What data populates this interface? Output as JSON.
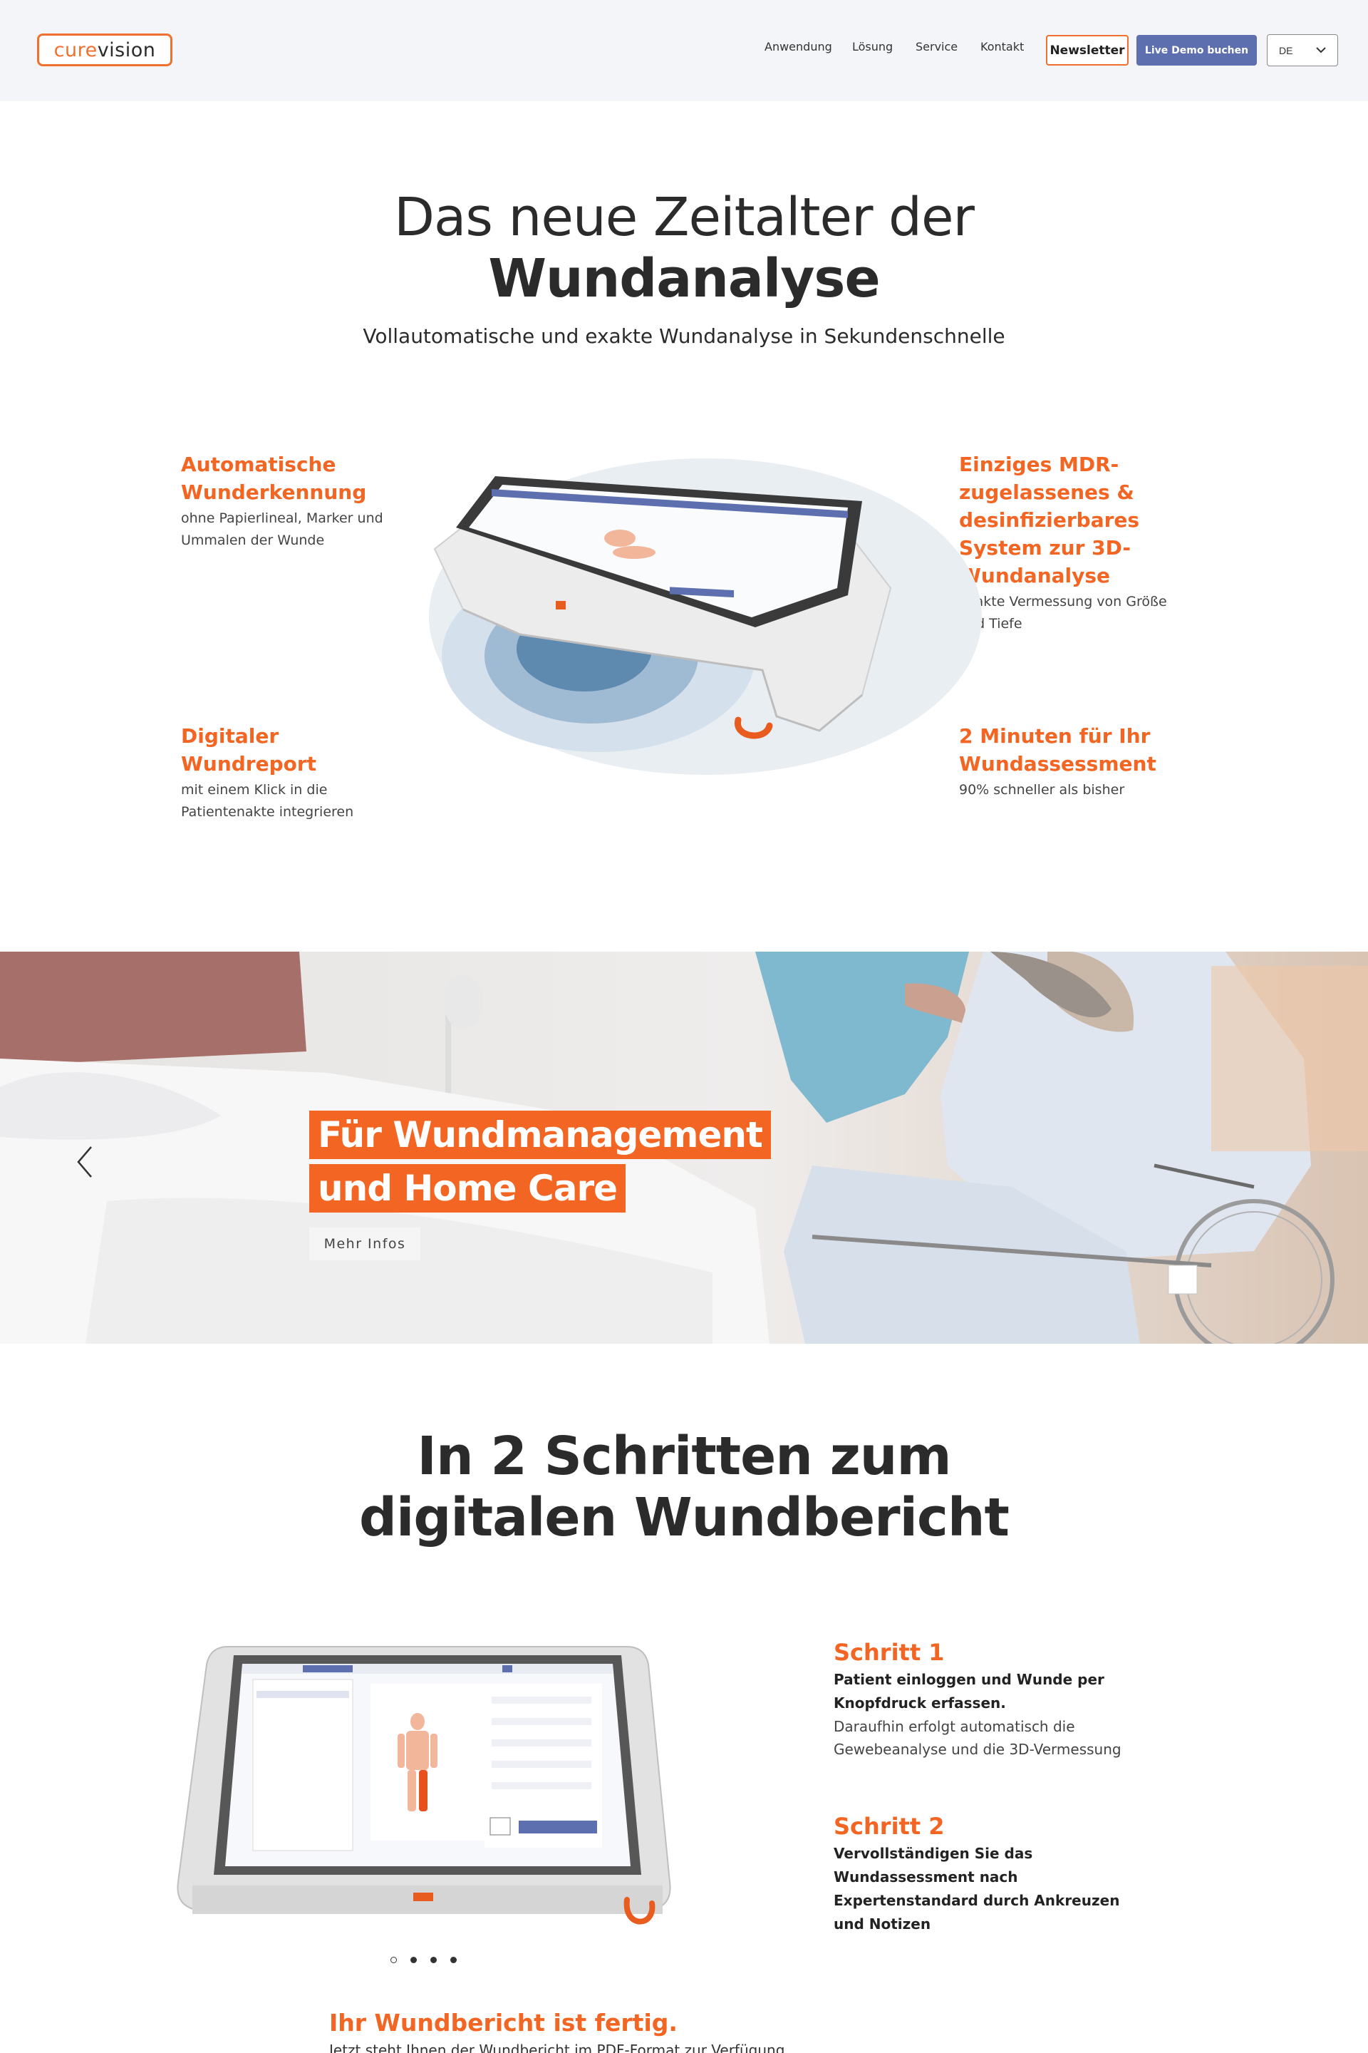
{
  "header": {
    "logo": {
      "part1": "cure",
      "part2": "vision"
    },
    "nav": [
      "Anwendung",
      "Lösung",
      "Service",
      "Kontakt"
    ],
    "newsletter": "Newsletter",
    "demo": "Live Demo buchen",
    "lang": "DE"
  },
  "hero": {
    "title_line1": "Das neue Zeitalter der",
    "title_line2": "Wundanalyse",
    "subtitle": "Vollautomatische und exakte Wundanalyse in Sekundenschnelle"
  },
  "features": [
    {
      "title": "Automatische Wunderkennung",
      "text": "ohne Papierlineal, Marker und Ummalen der Wunde"
    },
    {
      "title": "Einziges MDR-zugelassenes & desinfizierbares System zur 3D-Wundanalyse",
      "text": "exakte Vermessung von Größe und Tiefe"
    },
    {
      "title": "Digitaler Wundreport",
      "text": "mit einem Klick in die Patientenakte integrieren"
    },
    {
      "title": "2 Minuten für Ihr Wundassessment",
      "text": "90% schneller als bisher"
    }
  ],
  "banner": {
    "line1": "Für Wundmanagement",
    "line2": "und Home Care",
    "button": "Mehr Infos"
  },
  "steps": {
    "title_line1": "In 2 Schritten zum",
    "title_line2": "digitalen Wundbericht",
    "items": [
      {
        "title": "Schritt 1",
        "bold": "Patient einloggen und Wunde per Knopfdruck erfassen.",
        "text": "Daraufhin erfolgt automatisch die Gewebeanalyse und die 3D-Vermessung"
      },
      {
        "title": "Schritt 2",
        "bold": "Vervollständigen Sie das Wundassessment nach Expertenstandard durch Ankreuzen und Notizen",
        "text": ""
      }
    ],
    "carousel": {
      "count": 4,
      "active": 0
    }
  },
  "report": {
    "title": "Ihr Wundbericht ist fertig.",
    "text": "Jetzt steht Ihnen der Wundbericht im PDF-Format zur Verfügung"
  },
  "colors": {
    "accent": "#f26522",
    "demo": "#5e6fb0",
    "header_bg": "#f4f5f8"
  }
}
